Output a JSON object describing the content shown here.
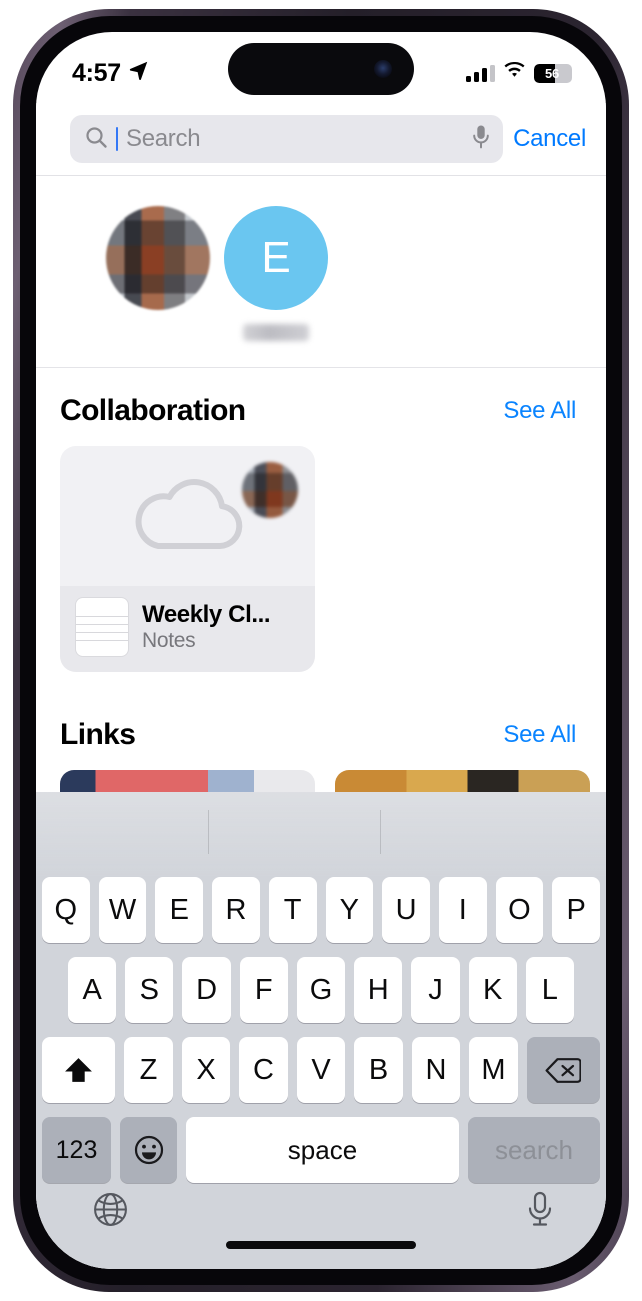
{
  "status_bar": {
    "time": "4:57",
    "location_icon": "location-arrow-icon",
    "cellular_icon": "cellular-bars-icon",
    "cellular_bars_filled": 3,
    "cellular_bars_total": 4,
    "wifi_icon": "wifi-icon",
    "battery_percent": "56",
    "battery_icon": "battery-icon"
  },
  "search": {
    "placeholder": "Search",
    "value": "",
    "search_icon": "search-icon",
    "mic_icon": "microphone-icon",
    "cancel_label": "Cancel"
  },
  "contacts": {
    "items": [
      {
        "name": "",
        "type": "photo",
        "redacted": true
      },
      {
        "name": "",
        "initial": "E",
        "type": "initial",
        "color": "#6ac6f0",
        "redacted": true
      }
    ]
  },
  "sections": [
    {
      "title": "Collaboration",
      "see_all_label": "See All",
      "cards": [
        {
          "preview_icon": "cloud-icon",
          "badge": "contact-avatar-badge",
          "app_icon": "notes-app-icon",
          "title": "Weekly Cl...",
          "subtitle": "Notes"
        }
      ]
    },
    {
      "title": "Links",
      "see_all_label": "See All",
      "cards": [
        {
          "thumbnail": "link-thumbnail-1"
        },
        {
          "thumbnail": "link-thumbnail-2"
        }
      ]
    }
  ],
  "keyboard": {
    "row1": [
      "Q",
      "W",
      "E",
      "R",
      "T",
      "Y",
      "U",
      "I",
      "O",
      "P"
    ],
    "row2": [
      "A",
      "S",
      "D",
      "F",
      "G",
      "H",
      "J",
      "K",
      "L"
    ],
    "row3_letters": [
      "Z",
      "X",
      "C",
      "V",
      "B",
      "N",
      "M"
    ],
    "shift_icon": "shift-arrow-icon",
    "backspace_icon": "backspace-delete-icon",
    "numbers_label": "123",
    "emoji_icon": "emoji-smiley-icon",
    "space_label": "space",
    "return_label": "search",
    "globe_icon": "globe-icon",
    "dictation_icon": "dictation-microphone-icon"
  },
  "colors": {
    "accent_blue": "#007aff",
    "link_blue": "#0a84ff",
    "avatar_blue": "#6ac6f0",
    "notes_yellow": "#fbc52d",
    "keyboard_bg": "#d1d4da"
  }
}
